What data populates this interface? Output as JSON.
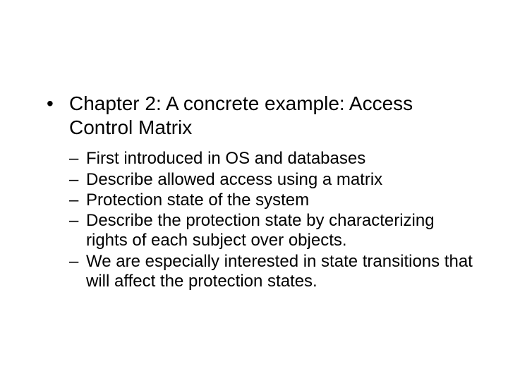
{
  "slide": {
    "main_bullet": "Chapter 2: A concrete example: Access Control Matrix",
    "sub_bullets": [
      "First introduced in OS and databases",
      "Describe allowed access using a matrix",
      "Protection state of the system",
      "Describe the protection state by characterizing rights of each subject over objects.",
      "We are especially interested in state transitions that will affect the protection states."
    ]
  }
}
